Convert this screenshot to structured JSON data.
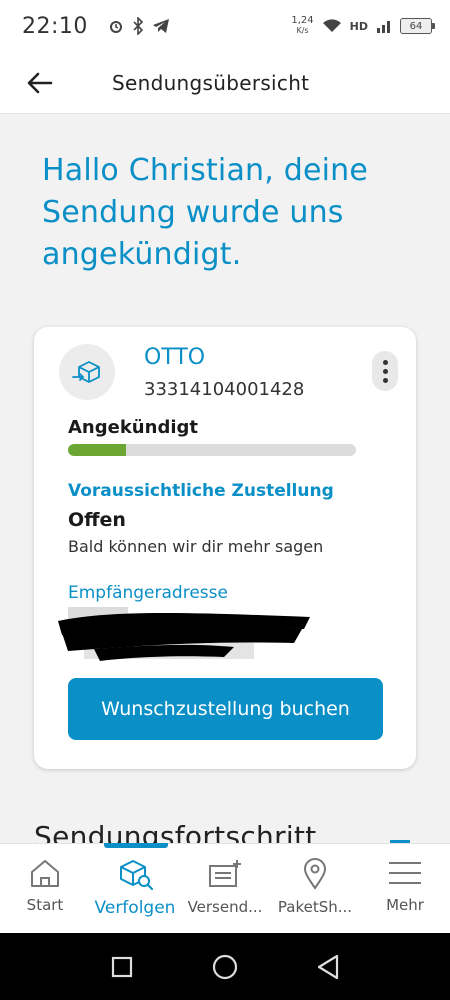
{
  "status_bar": {
    "time": "22:10",
    "net_speed_value": "1,24",
    "net_speed_unit": "K/s",
    "network_label": "HD",
    "battery": "64"
  },
  "app_bar": {
    "title": "Sendungsübersicht"
  },
  "greeting": "Hallo Christian, deine Sendung wurde uns angekündigt.",
  "shipment": {
    "sender": "OTTO",
    "tracking_number": "33314104001428",
    "status_label": "Angekündigt",
    "progress_fraction": 0.2,
    "delivery_heading": "Voraussichtliche Zustellung",
    "delivery_status": "Offen",
    "delivery_note": "Bald können wir dir mehr sagen",
    "address_heading": "Empfängeradresse",
    "cta_label": "Wunschzustellung buchen"
  },
  "section_title": "Sendungsfortschritt",
  "colors": {
    "brand_blue": "#0a8fc7",
    "progress_green": "#6aa631"
  },
  "bottom_nav": [
    {
      "label": "Start",
      "icon": "home-icon"
    },
    {
      "label": "Verfolgen",
      "icon": "package-search-icon",
      "active": true
    },
    {
      "label": "Versend...",
      "icon": "send-package-icon"
    },
    {
      "label": "PaketSh...",
      "icon": "location-pin-icon"
    },
    {
      "label": "Mehr",
      "icon": "menu-icon"
    }
  ]
}
